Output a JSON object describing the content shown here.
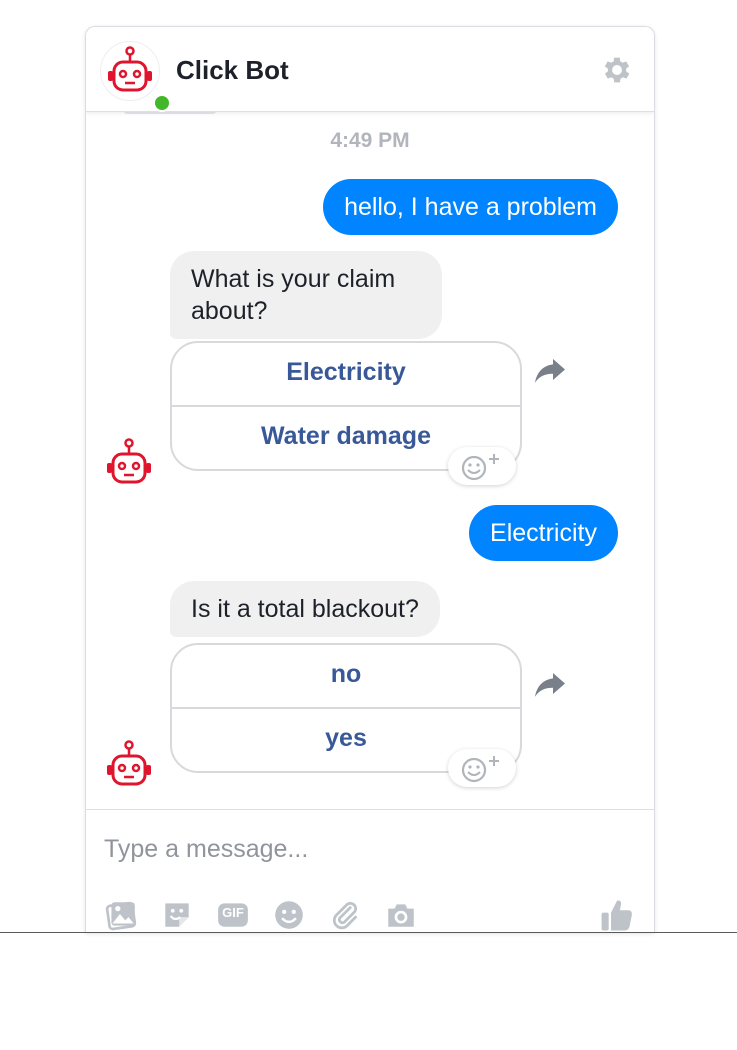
{
  "header": {
    "title": "Click Bot"
  },
  "chat": {
    "timestamp": "4:49 PM",
    "messages": [
      {
        "from": "user",
        "text": "hello, I have a problem"
      },
      {
        "from": "bot",
        "text": "What is your claim about?"
      },
      {
        "from": "bot",
        "quick_replies": [
          "Electricity",
          "Water damage"
        ]
      },
      {
        "from": "user",
        "text": "Electricity"
      },
      {
        "from": "bot",
        "text": "Is it a total blackout?"
      },
      {
        "from": "bot",
        "quick_replies": [
          "no",
          "yes"
        ]
      }
    ]
  },
  "composer": {
    "placeholder": "Type a message...",
    "tools": [
      "photo-icon",
      "sticker-icon",
      "gif-icon",
      "emoji-icon",
      "attachment-icon",
      "camera-icon"
    ],
    "gif_label": "GIF",
    "like_icon": "thumbs-up-icon"
  },
  "colors": {
    "accent": "#0084ff",
    "bot_red": "#e0142c",
    "online": "#42b72a",
    "quick_reply_text": "#385898"
  }
}
